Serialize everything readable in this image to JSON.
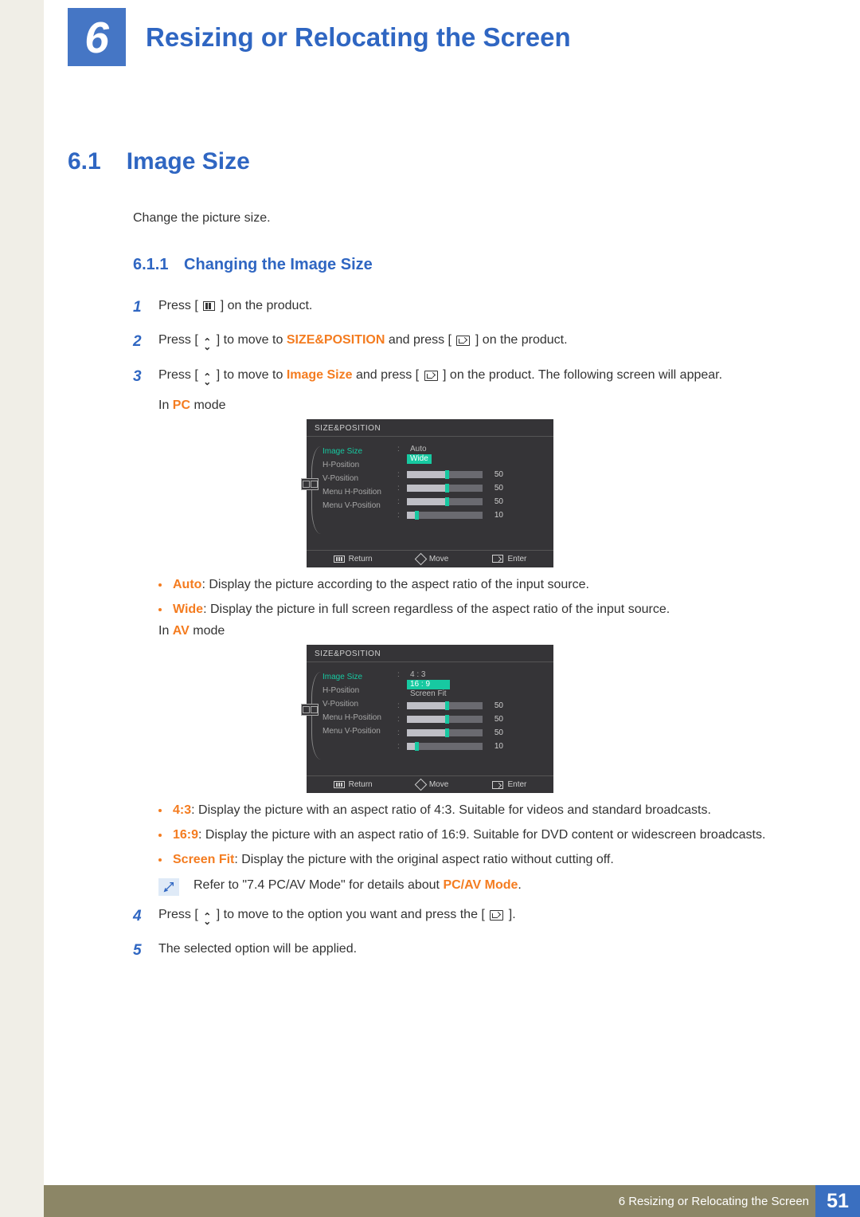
{
  "chapter": {
    "number": "6",
    "title": "Resizing or Relocating the Screen"
  },
  "section": {
    "number": "6.1",
    "title": "Image Size",
    "intro": "Change the picture size."
  },
  "subsection": {
    "number": "6.1.1",
    "title": "Changing the Image Size"
  },
  "icons": {
    "updown": "⌃⌄"
  },
  "steps": {
    "s1": {
      "num": "1",
      "t1": "Press [",
      "t2": "] on the product."
    },
    "s2": {
      "num": "2",
      "t1": "Press [",
      "t2": "] to move to ",
      "menu": "SIZE&POSITION",
      "t3": " and press [",
      "t4": "] on the product."
    },
    "s3": {
      "num": "3",
      "t1": "Press [",
      "t2": "] to move to ",
      "item": "Image Size",
      "t3": " and press [",
      "t4": "] on the product. The following screen will appear."
    },
    "s4": {
      "num": "4",
      "t1": "Press [",
      "t2": "] to move to the option you want and press the [",
      "t3": "]."
    },
    "s5": {
      "num": "5",
      "text": "The selected option will be applied."
    }
  },
  "mode_pc": {
    "prefix": "In ",
    "label": "PC",
    "suffix": " mode"
  },
  "mode_av": {
    "prefix": "In ",
    "label": "AV",
    "suffix": " mode"
  },
  "osd": {
    "title": "SIZE&POSITION",
    "labels": {
      "image_size": "Image Size",
      "h_position": "H-Position",
      "v_position": "V-Position",
      "menu_h": "Menu H-Position",
      "menu_v": "Menu V-Position"
    },
    "sliders": {
      "h": "50",
      "v": "50",
      "mh": "50",
      "mv": "10"
    },
    "pc_opts": {
      "a": "Auto",
      "b": "Wide"
    },
    "av_opts": {
      "a": "4 : 3",
      "b": "16 : 9",
      "c": "Screen Fit"
    },
    "footer": {
      "return": "Return",
      "move": "Move",
      "enter": "Enter"
    }
  },
  "bullets_pc": {
    "auto": {
      "label": "Auto",
      "text": ": Display the picture according to the aspect ratio of the input source."
    },
    "wide": {
      "label": "Wide",
      "text": ": Display the picture in full screen regardless of the aspect ratio of the input source."
    }
  },
  "bullets_av": {
    "r43": {
      "label": "4:3",
      "text": ": Display the picture with an aspect ratio of 4:3. Suitable for videos and standard broadcasts."
    },
    "r169": {
      "label": "16:9",
      "text": ": Display the picture with an aspect ratio of 16:9. Suitable for DVD content or widescreen broadcasts."
    },
    "fit": {
      "label": "Screen Fit",
      "text": ": Display the picture with the original aspect ratio without cutting off."
    }
  },
  "note": {
    "t1": "Refer to \"7.4 PC/AV Mode\" for details about ",
    "link": "PC/AV Mode",
    "t2": "."
  },
  "footer": {
    "text": "6 Resizing or Relocating the Screen",
    "page": "51"
  }
}
